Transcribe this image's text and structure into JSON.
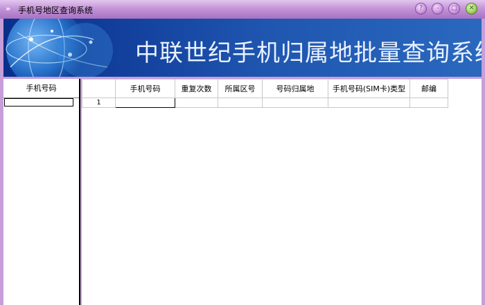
{
  "window": {
    "title": "手机号地区查询系统"
  },
  "banner": {
    "title": "中联世纪手机归属地批量查询系统"
  },
  "left_panel": {
    "header": "手机号码",
    "input_value": ""
  },
  "grid": {
    "columns": [
      "",
      "手机号码",
      "重复次数",
      "所属区号",
      "号码归属地",
      "手机号码(SIM卡)类型",
      "邮编"
    ],
    "rows": [
      {
        "index": "1",
        "phone": "",
        "repeat": "",
        "area_code": "",
        "location": "",
        "sim_type": "",
        "zip": ""
      }
    ]
  },
  "colors": {
    "window_frame": "#c79ed8",
    "banner_bg": "#12409c",
    "banner_text": "#e9f1ff",
    "close_button": "#9ed05a"
  },
  "icons": [
    "chevron-right-icon",
    "help-icon",
    "minimize-icon",
    "maximize-icon",
    "close-icon"
  ]
}
